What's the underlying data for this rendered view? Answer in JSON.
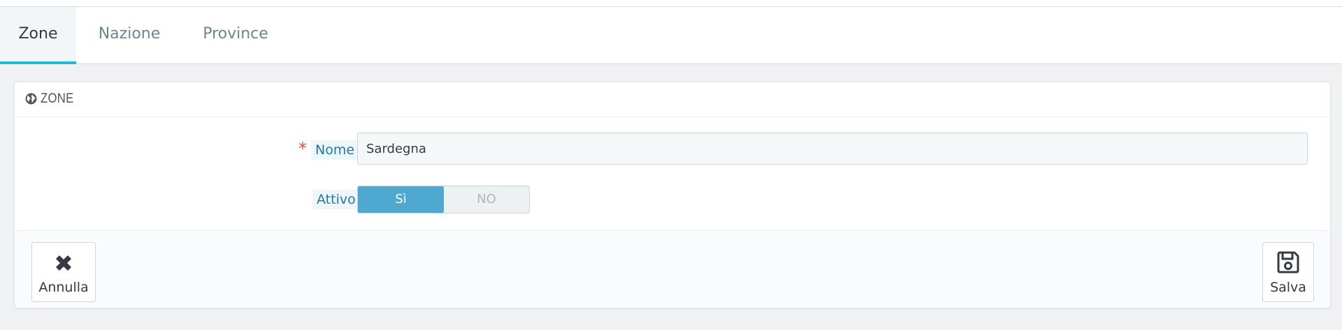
{
  "tabs": [
    {
      "label": "Zone",
      "active": true
    },
    {
      "label": "Nazione",
      "active": false
    },
    {
      "label": "Province",
      "active": false
    }
  ],
  "panel": {
    "icon": "globe-icon",
    "title": "ZONE"
  },
  "form": {
    "name_required_marker": "*",
    "name_label": "Nome",
    "name_value": "Sardegna",
    "active_label": "Attivo",
    "active_yes": "Sì",
    "active_no": "NO",
    "active_selected": "yes"
  },
  "footer": {
    "cancel_label": "Annulla",
    "cancel_icon": "close-icon",
    "save_label": "Salva",
    "save_icon": "floppy-disk-icon"
  },
  "colors": {
    "accent": "#25b9d7",
    "switch_on": "#4fa8d0",
    "label_text": "#25789c",
    "required": "#e84e3e"
  }
}
